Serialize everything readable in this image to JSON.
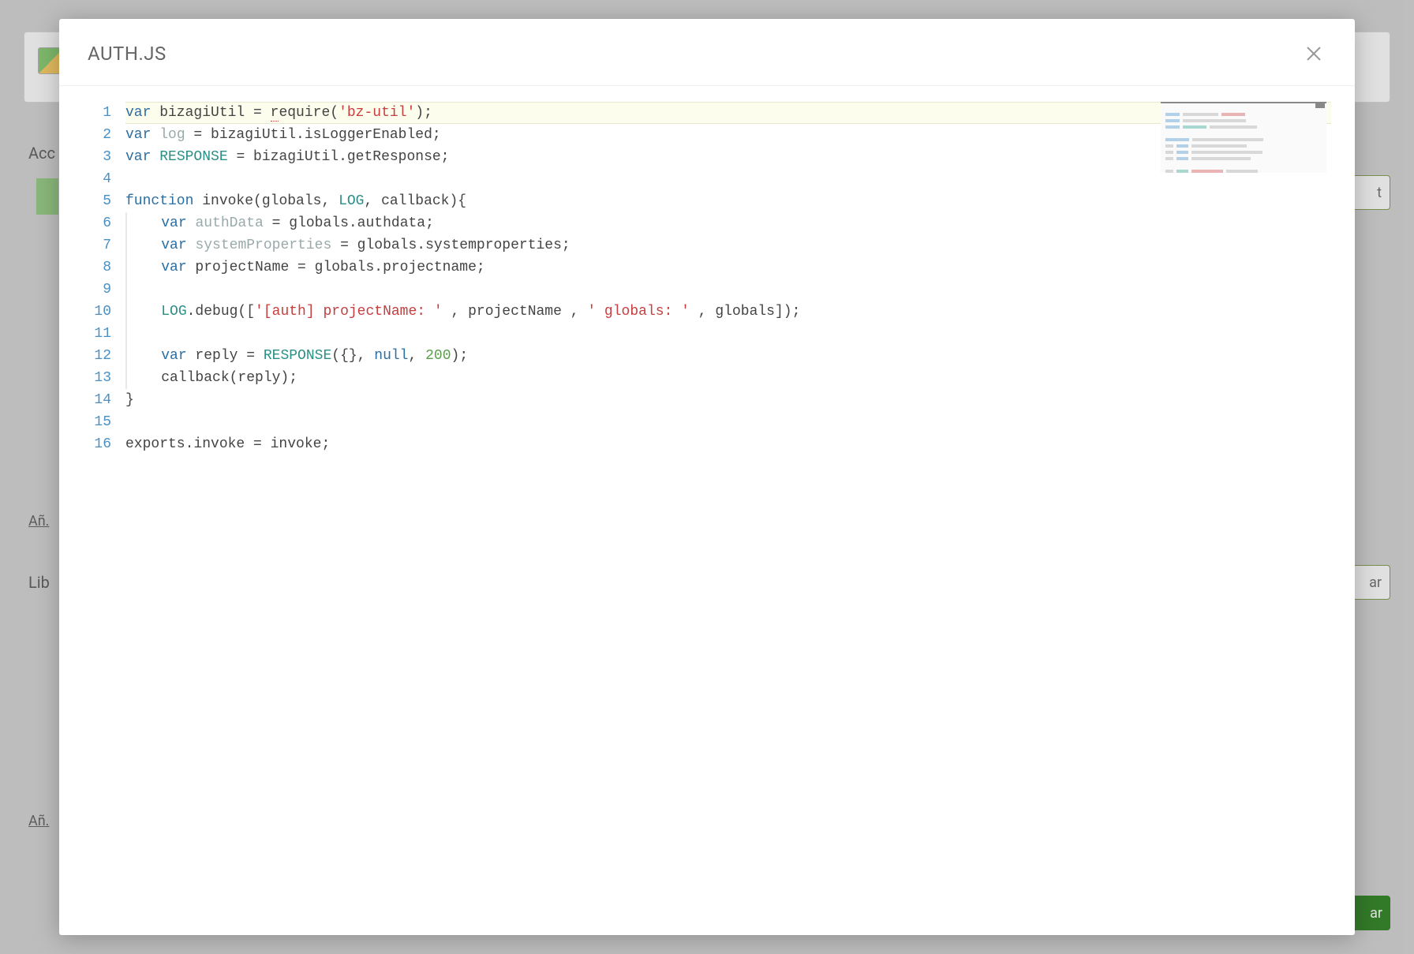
{
  "modal": {
    "title": "AUTH.JS"
  },
  "background": {
    "label_acc": "Acc",
    "label_lib": "Lib",
    "link_add_1": "Añ.",
    "link_add_2": "Añ.",
    "btn_t": "t",
    "btn_ar": "ar",
    "btn_primary": "ar"
  },
  "editor": {
    "lines": [
      {
        "n": 1,
        "html": "<span class='kw'>var</span> bizagiUtil = <span style='border-bottom:1px dotted #c73e3e;'>r</span>equire(<span class='str'>'bz-util'</span>);"
      },
      {
        "n": 2,
        "html": "<span class='kw'>var</span> <span class='var-dim'>log</span> = bizagiUtil.isLoggerEnabled;"
      },
      {
        "n": 3,
        "html": "<span class='kw'>var</span> <span class='call-up'>RESPONSE</span> = bizagiUtil.getResponse;"
      },
      {
        "n": 4,
        "html": ""
      },
      {
        "n": 5,
        "html": "<span class='kw'>function</span> invoke(globals, <span class='call-up'>LOG</span>, callback){"
      },
      {
        "n": 6,
        "html": "    <span class='kw'>var</span> <span class='var-dim'>authData</span> = globals.authdata;"
      },
      {
        "n": 7,
        "html": "    <span class='kw'>var</span> <span class='var-dim'>systemProperties</span> = globals.systemproperties;"
      },
      {
        "n": 8,
        "html": "    <span class='kw'>var</span> projectName = globals.projectname;"
      },
      {
        "n": 9,
        "html": ""
      },
      {
        "n": 10,
        "html": "    <span class='call-up'>LOG</span>.debug([<span class='str'>'[auth] projectName: '</span> , projectName , <span class='str'>' globals: '</span> , globals]);"
      },
      {
        "n": 11,
        "html": ""
      },
      {
        "n": 12,
        "html": "    <span class='kw'>var</span> reply = <span class='call-up'>RESPONSE</span>({}, <span class='null'>null</span>, <span class='num'>200</span>);"
      },
      {
        "n": 13,
        "html": "    callback(reply);"
      },
      {
        "n": 14,
        "html": "}"
      },
      {
        "n": 15,
        "html": ""
      },
      {
        "n": 16,
        "html": "exports.invoke = invoke;"
      }
    ],
    "active_line": 1,
    "indent_lines": [
      6,
      7,
      8,
      9,
      10,
      11,
      12,
      13
    ]
  }
}
